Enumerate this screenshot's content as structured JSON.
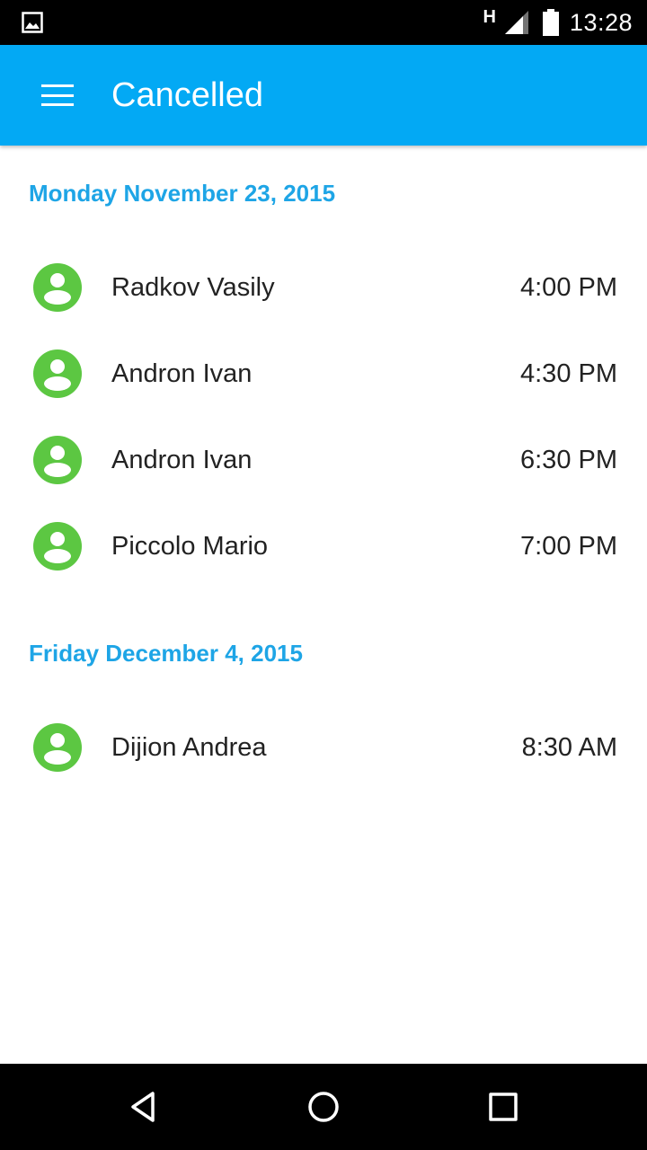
{
  "status_bar": {
    "network_type": "H",
    "time": "13:28",
    "notification_icon": "image-icon",
    "signal_icon": "signal-icon",
    "battery_icon": "battery-icon"
  },
  "app_bar": {
    "title": "Cancelled",
    "menu_icon": "menu-icon",
    "background_color": "#03A9F4"
  },
  "colors": {
    "section_header": "#1EA5E6",
    "avatar": "#5CC742",
    "text_primary": "#222222"
  },
  "sections": [
    {
      "date": "Monday November 23, 2015",
      "items": [
        {
          "name": "Radkov Vasily",
          "time": "4:00 PM"
        },
        {
          "name": "Andron Ivan",
          "time": "4:30 PM"
        },
        {
          "name": "Andron Ivan",
          "time": "6:30 PM"
        },
        {
          "name": "Piccolo Mario",
          "time": "7:00 PM"
        }
      ]
    },
    {
      "date": "Friday December 4, 2015",
      "items": [
        {
          "name": "Dijion Andrea",
          "time": "8:30 AM"
        }
      ]
    }
  ],
  "nav_bar": {
    "back_icon": "back-triangle-icon",
    "home_icon": "home-circle-icon",
    "recents_icon": "recents-square-icon"
  }
}
